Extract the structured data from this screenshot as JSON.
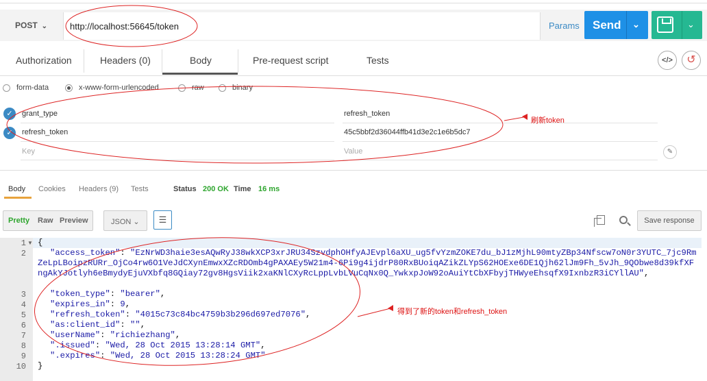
{
  "request": {
    "method": "POST",
    "url": "http://localhost:56645/token",
    "params_label": "Params",
    "send_label": "Send"
  },
  "tabs": [
    "Authorization",
    "Headers (0)",
    "Body",
    "Pre-request script",
    "Tests"
  ],
  "body_types": [
    "form-data",
    "x-www-form-urlencoded",
    "raw",
    "binary"
  ],
  "form_rows": [
    {
      "key": "grant_type",
      "value": "refresh_token"
    },
    {
      "key": "refresh_token",
      "value": "45c5bbf2d36044ffb41d3e2c1e6b5dc7"
    }
  ],
  "placeholders": {
    "key": "Key",
    "value": "Value"
  },
  "annotation_request": "刷新token",
  "response_tabs": [
    "Body",
    "Cookies",
    "Headers (9)",
    "Tests"
  ],
  "status": {
    "status_label": "Status",
    "status_value": "200 OK",
    "time_label": "Time",
    "time_value": "16 ms"
  },
  "view_modes": [
    "Pretty",
    "Raw",
    "Preview"
  ],
  "format": "JSON",
  "save_response_label": "Save response",
  "line_numbers": [
    "1",
    "2",
    "",
    "",
    "",
    "3",
    "4",
    "5",
    "6",
    "7",
    "8",
    "9",
    "10"
  ],
  "code": {
    "open": "{",
    "access_token_key": "\"access_token\"",
    "access_token_value": "\"EzNrWD3haie3esAQwRyJ38wkXCP3xrJRU34SzvdphOHfyAJEvpl6aXU_ug5fvYzmZOKE7du_bJ1zMjhL90mtyZBp34Nfscw7oN0r3YUTC_7jc9RmZeLpLBoipzRURr_OjCo4rw6O1VeJdCXynEmwxXZcRDOmb4gPAXAEy5W21m4-6Pi9g4ijdrP80RxBUoiqAZikZLYpS62HOExe6DE1Qjh62lJm9Fh_5vJh_9QObwe8d39kfXFngAkYJotlyh6eBmydyEjuVXbfq8GQiay72gv8HgsViik2xaKNlCXyRcLppLvbLVuCqNx0Q_YwkxpJoW92oAuiYtCbXFbyjTHWyeEhsqfX9IxnbzR3iCYllAU\"",
    "token_type_key": "\"token_type\"",
    "token_type_value": "\"bearer\"",
    "expires_in_key": "\"expires_in\"",
    "expires_in_value": "9",
    "refresh_token_key": "\"refresh_token\"",
    "refresh_token_value": "\"4015c73c84bc4759b3b296d697ed7076\"",
    "client_id_key": "\"as:client_id\"",
    "client_id_value": "\"\"",
    "username_key": "\"userName\"",
    "username_value": "\"richiezhang\"",
    "issued_key": "\".issued\"",
    "issued_value": "\"Wed, 28 Oct 2015 13:28:14 GMT\"",
    "expires_key": "\".expires\"",
    "expires_value": "\"Wed, 28 Oct 2015 13:28:24 GMT\"",
    "close": "}"
  },
  "annotation_response": "得到了新的token和refresh_token",
  "colors": {
    "send": "#1e90e6",
    "save": "#25b892",
    "annotation": "#dd1111",
    "status_ok": "#2ea52e",
    "tab_accent": "#e8a33d"
  }
}
